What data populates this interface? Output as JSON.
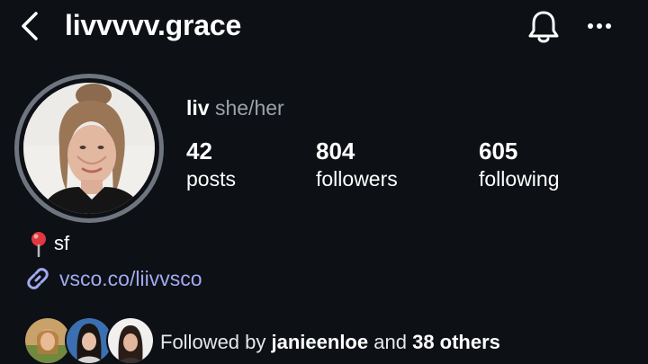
{
  "header": {
    "username": "livvvvv.grace",
    "back_icon": "chevron-left-icon",
    "bell_icon": "bell-icon",
    "more_icon": "more-horizontal-icon"
  },
  "profile": {
    "name": "liv",
    "pronouns": "she/her",
    "stats": [
      {
        "value": "42",
        "label": "posts"
      },
      {
        "value": "804",
        "label": "followers"
      },
      {
        "value": "605",
        "label": "following"
      }
    ]
  },
  "bio": {
    "location_icon": "pin-icon",
    "location": "sf",
    "link_icon": "link-icon",
    "link": "vsco.co/liivvsco"
  },
  "followed_by": {
    "prefix": "Followed by",
    "user": "janieenloe",
    "conjunction": "and",
    "others": "38 others"
  },
  "colors": {
    "background": "#0d1015",
    "link": "#a1a9f0",
    "muted": "#9ca2ab",
    "ring": "#6f757f"
  }
}
